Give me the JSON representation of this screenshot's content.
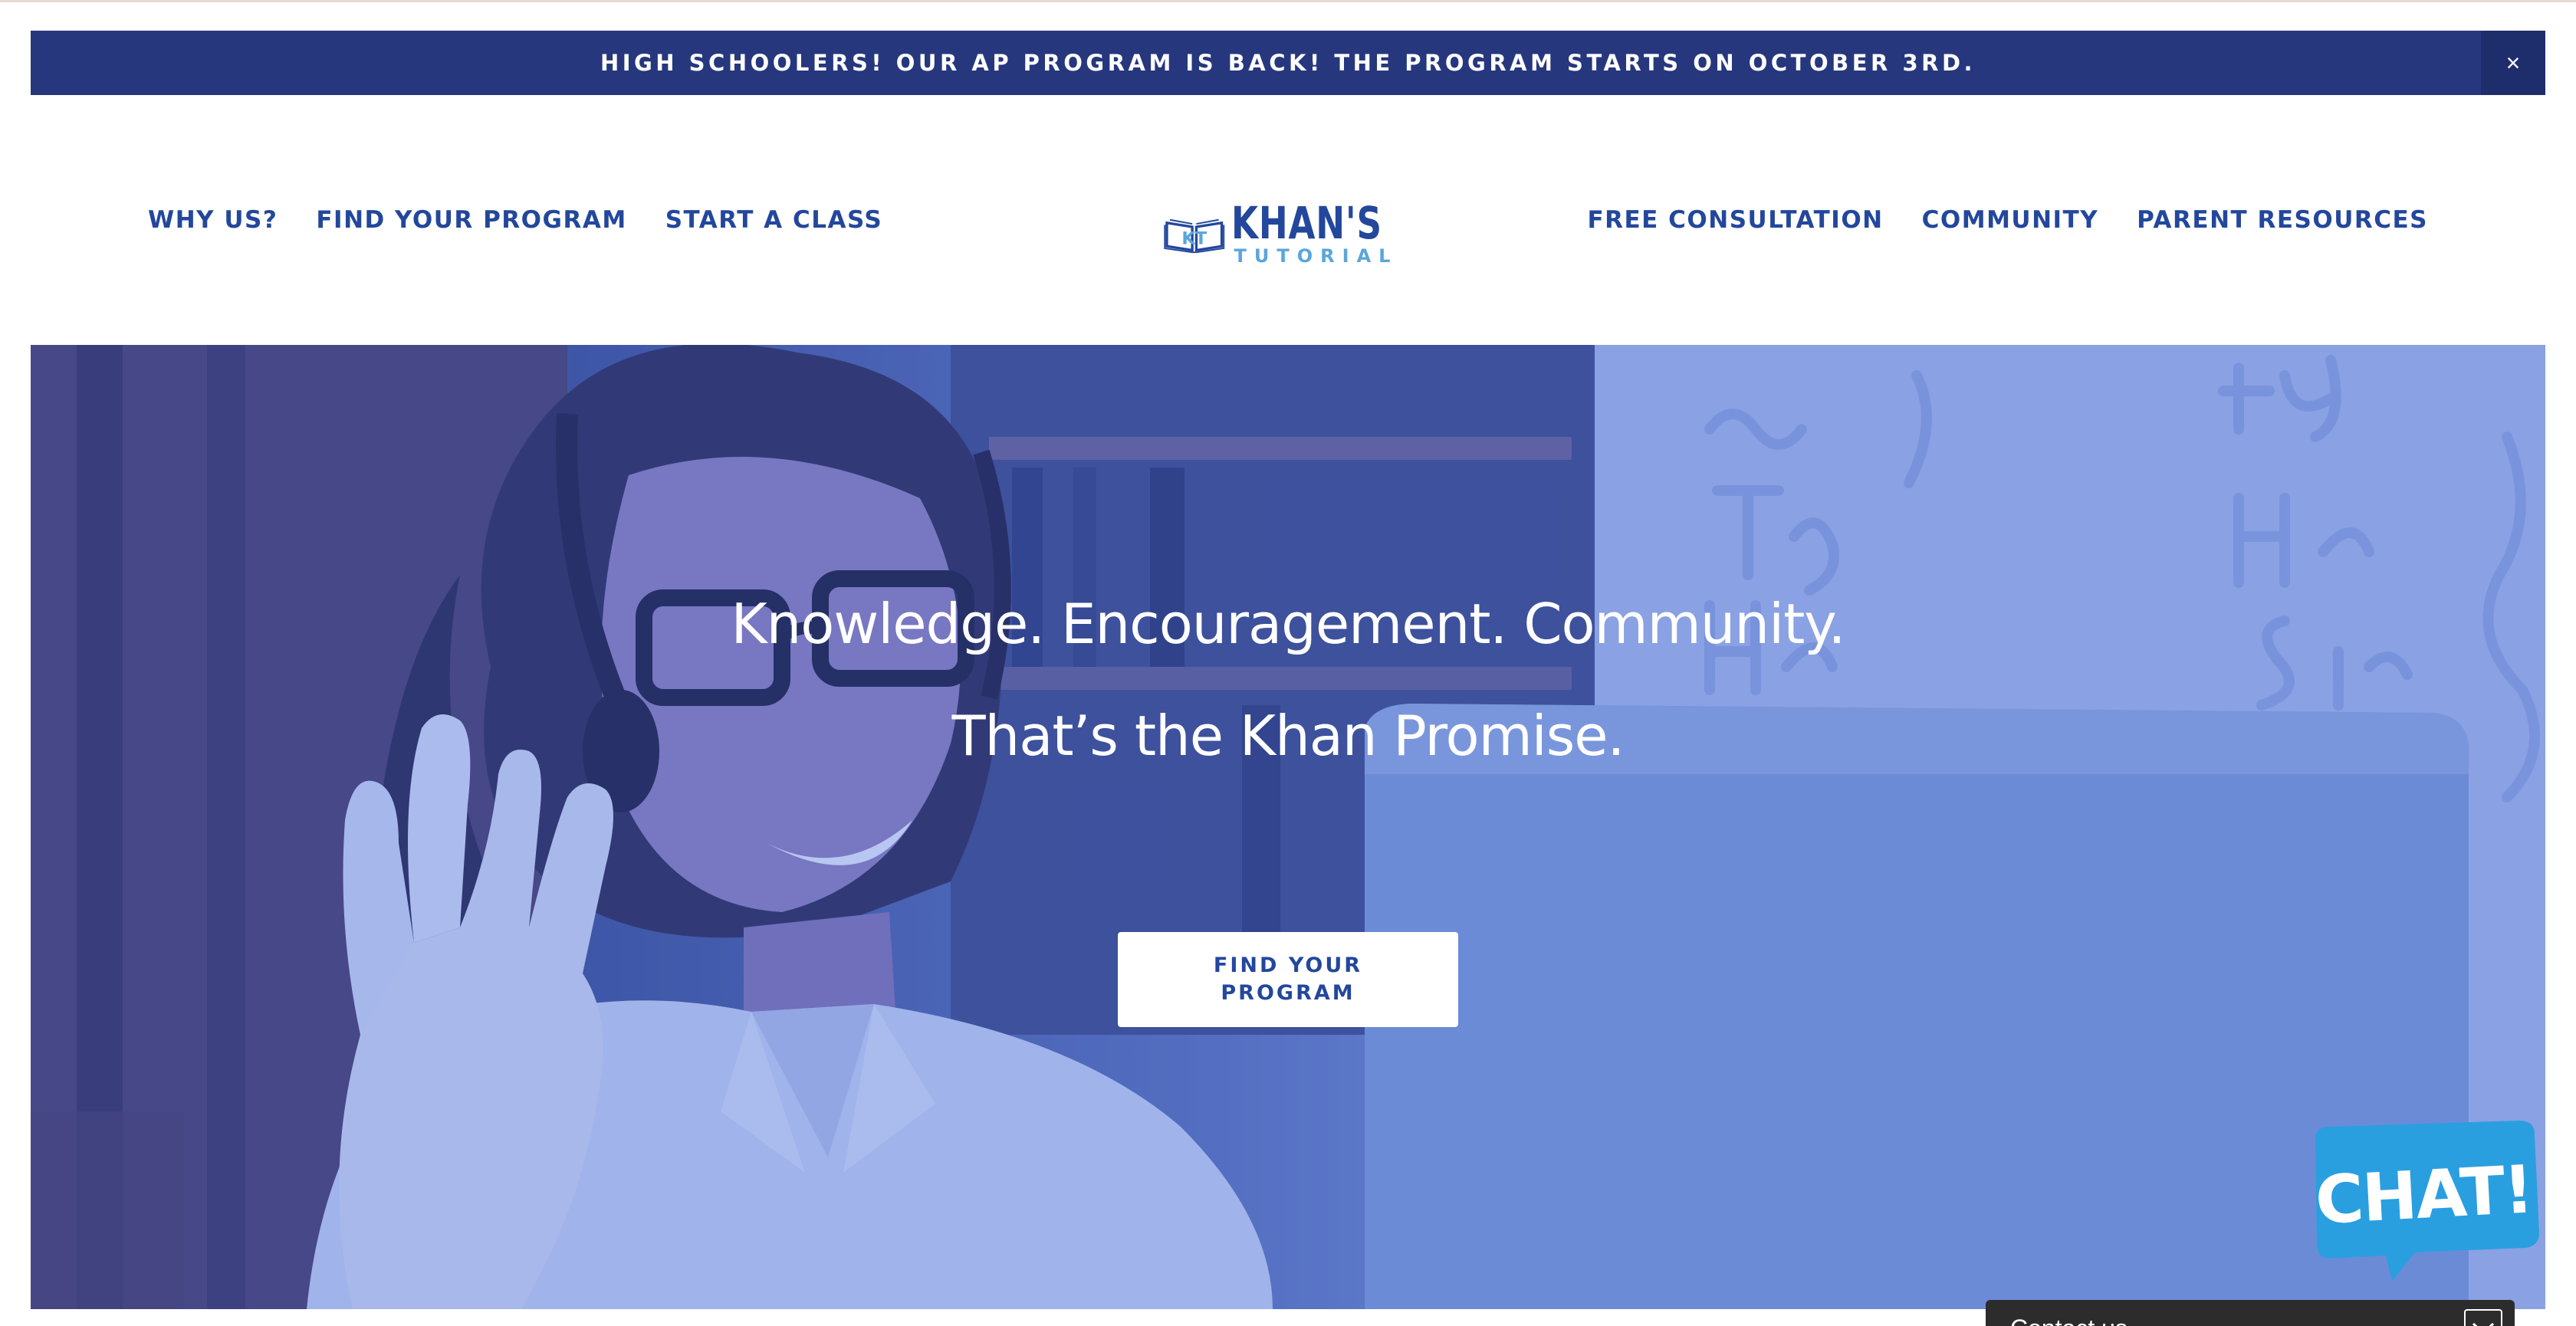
{
  "announcement": {
    "text": "HIGH SCHOOLERS! OUR AP PROGRAM IS BACK! THE PROGRAM STARTS ON OCTOBER 3RD.",
    "close_symbol": "×"
  },
  "nav_left": [
    {
      "label": "WHY US?"
    },
    {
      "label": "FIND YOUR PROGRAM"
    },
    {
      "label": "START A CLASS"
    }
  ],
  "nav_right": [
    {
      "label": "FREE CONSULTATION"
    },
    {
      "label": "COMMUNITY"
    },
    {
      "label": "PARENT RESOURCES"
    }
  ],
  "logo": {
    "mark": "KT",
    "title": "KHAN'S",
    "subtitle": "TUTORIAL",
    "icon": "open-book-icon"
  },
  "hero": {
    "line1": "Knowledge. Encouragement. Community.",
    "line2": "That’s the Khan Promise.",
    "button_label": "FIND YOUR PROGRAM",
    "image_subject": "hero-photo"
  },
  "chat": {
    "label": "CHAT!",
    "icon": "speech-bubble-icon"
  },
  "contact": {
    "label": "Contact us",
    "icon": "chevron-down-icon"
  },
  "colors": {
    "brand_navy": "#26377e",
    "brand_blue": "#23479c",
    "brand_light_blue": "#5aa6dc",
    "chat_blue": "#2a9fe0",
    "contact_bg": "#2c2c2c"
  }
}
